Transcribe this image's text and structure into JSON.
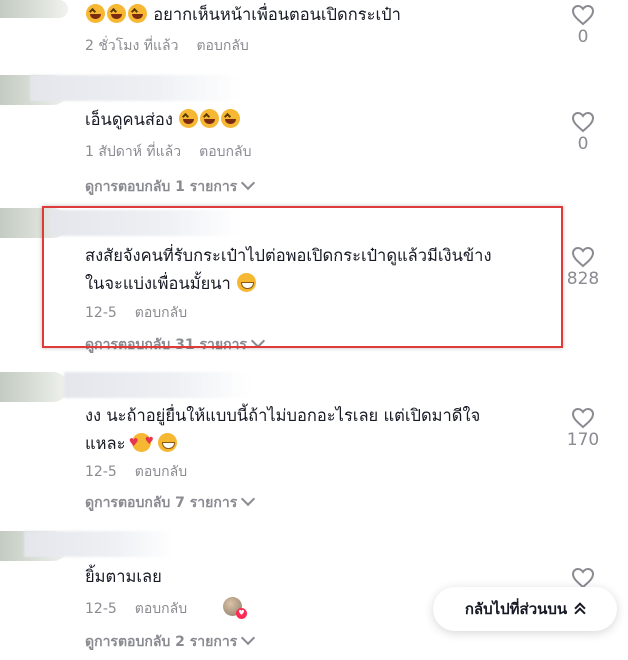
{
  "comments": [
    {
      "text": "อยากเห็นหน้าเพื่อนตอนเปิดกระเป๋า",
      "time": "2 ชั่วโมง ที่แล้ว",
      "reply_label": "ตอบกลับ",
      "likes": "0"
    },
    {
      "text": "เอ็นดูคนส่อง",
      "time": "1 สัปดาห์ ที่แล้ว",
      "reply_label": "ตอบกลับ",
      "likes": "0",
      "view_replies": "ดูการตอบกลับ 1 รายการ"
    },
    {
      "text_line1": "สงสัยจังคนที่รับกระเป๋าไปต่อพอเปิดกระเป๋าดูแล้วมีเงินข้าง",
      "text_line2": "ในจะแบ่งเพื่อนมั้ยนา",
      "time": "12-5",
      "reply_label": "ตอบกลับ",
      "likes": "828",
      "view_replies": "ดูการตอบกลับ 31 รายการ"
    },
    {
      "text_line1": "งง นะถ้าอยู่ยื่นให้แบบนี้ถ้าไม่บอกอะไรเลย แต่เปิดมาดีใจ",
      "text_line2": "แหละ",
      "time": "12-5",
      "reply_label": "ตอบกลับ",
      "likes": "170",
      "view_replies": "ดูการตอบกลับ 7 รายการ"
    },
    {
      "text": "ยิ้มตามเลย",
      "time": "12-5",
      "reply_label": "ตอบกลับ",
      "view_replies": "ดูการตอบกลับ 2 รายการ"
    }
  ],
  "back_to_top": "กลับไปที่ส่วนบน",
  "colors": {
    "highlight": "#e03b3b",
    "muted": "#8a8b91",
    "text": "#161823"
  }
}
